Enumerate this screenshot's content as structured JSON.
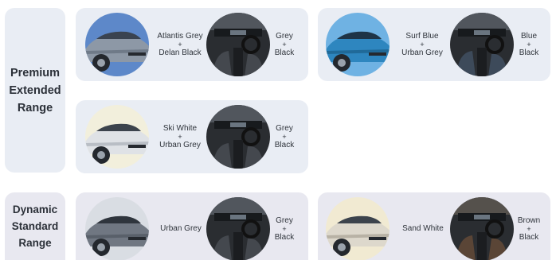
{
  "colors": {
    "premium_bg": "#e9edf4",
    "dynamic_bg": "#e8e8f0"
  },
  "trims": [
    {
      "label_lines": [
        "Premium",
        "Extended",
        "Range"
      ],
      "options": [
        {
          "exterior_lines": [
            "Atlantis Grey",
            "+",
            "Delan Black"
          ],
          "exterior_icon": "atlantis-grey-car-icon",
          "interior_lines": [
            "Grey",
            "+",
            "Black"
          ],
          "interior_icon": "grey-black-interior-icon"
        },
        {
          "exterior_lines": [
            "Surf Blue",
            "+",
            "Urban Grey"
          ],
          "exterior_icon": "surf-blue-car-icon",
          "interior_lines": [
            "Blue",
            "+",
            "Black"
          ],
          "interior_icon": "blue-black-interior-icon"
        },
        {
          "exterior_lines": [
            "Ski White",
            "+",
            "Urban Grey"
          ],
          "exterior_icon": "ski-white-car-icon",
          "interior_lines": [
            "Grey",
            "+",
            "Black"
          ],
          "interior_icon": "grey-black-interior-icon"
        }
      ]
    },
    {
      "label_lines": [
        "Dynamic",
        "Standard",
        "Range"
      ],
      "options": [
        {
          "exterior_lines": [
            "Urban Grey"
          ],
          "exterior_icon": "urban-grey-car-icon",
          "interior_lines": [
            "Grey",
            "+",
            "Black"
          ],
          "interior_icon": "grey-black-interior-icon"
        },
        {
          "exterior_lines": [
            "Sand White"
          ],
          "exterior_icon": "sand-white-car-icon",
          "interior_lines": [
            "Brown",
            "+",
            "Black"
          ],
          "interior_icon": "brown-black-interior-icon"
        }
      ]
    }
  ]
}
